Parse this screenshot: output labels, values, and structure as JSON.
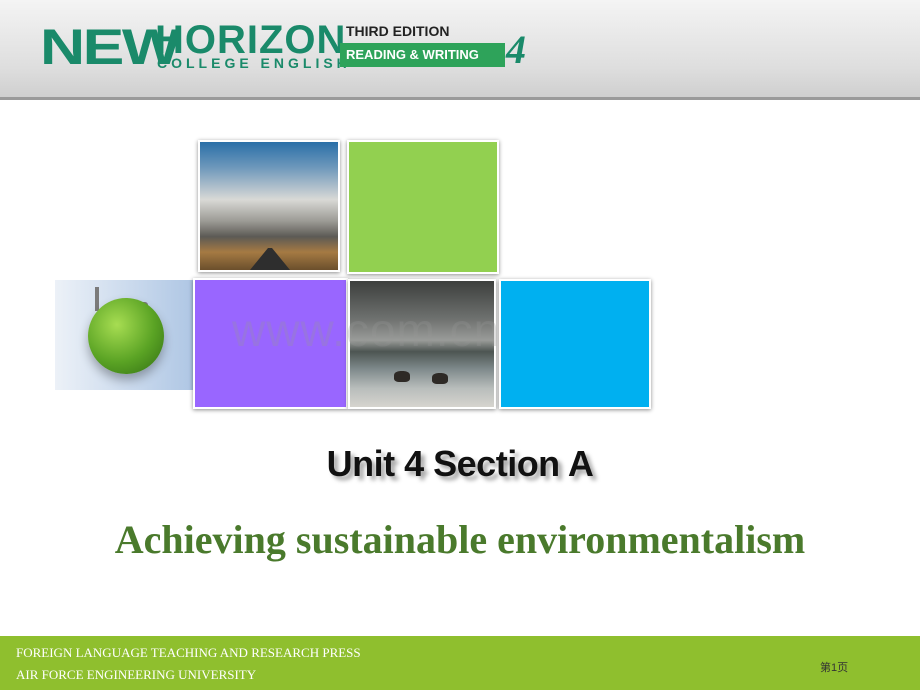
{
  "header": {
    "logo_new": "NEW",
    "logo_horizon": "HORIZON",
    "logo_college": "COLLEGE ENGLISH",
    "edition": "THIRD EDITION",
    "series": "READING & WRITING",
    "book_number": "4"
  },
  "watermark": "www.com.cn",
  "content": {
    "unit_title": "Unit 4 Section A",
    "subtitle": "Achieving sustainable environmentalism"
  },
  "footer": {
    "publisher_line1": "FOREIGN LANGUAGE TEACHING AND RESEARCH PRESS",
    "publisher_line2": "AIR FORCE ENGINEERING UNIVERSITY",
    "page_label": "第1页"
  },
  "colors": {
    "brand_green": "#1a8a6a",
    "tile_green": "#92d050",
    "tile_purple": "#9966ff",
    "tile_blue": "#00b0f0",
    "footer_green": "#8fbf2e",
    "subtitle_green": "#4a7a2c"
  }
}
